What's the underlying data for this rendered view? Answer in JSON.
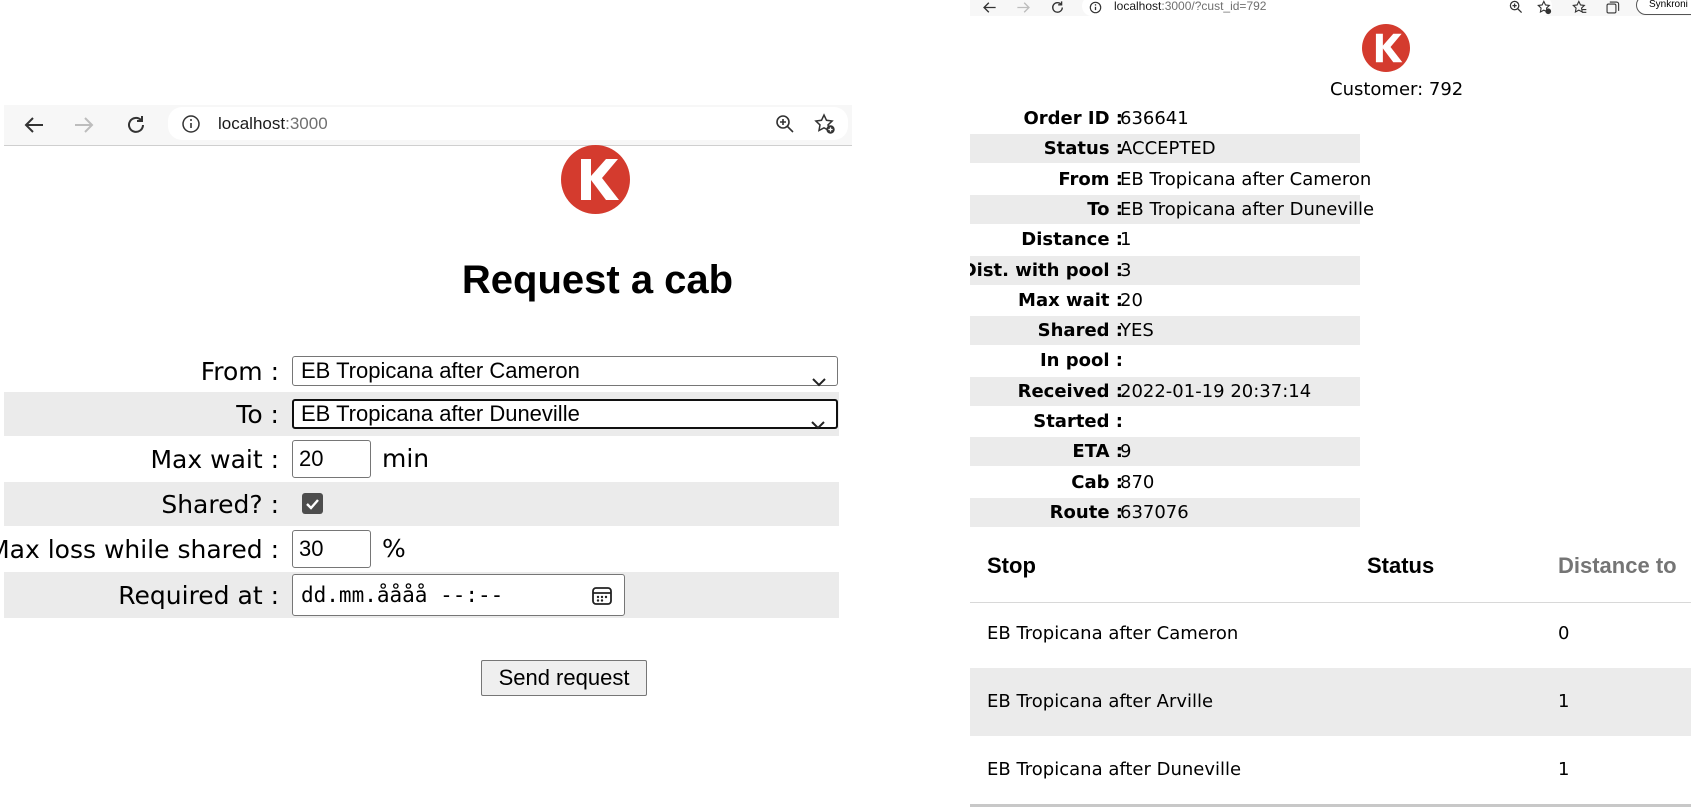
{
  "left": {
    "browser": {
      "url_host": "localhost",
      "url_port": ":3000"
    },
    "form": {
      "title": "Request a cab",
      "rows": {
        "from": {
          "label": "From :",
          "value": "EB Tropicana after Cameron"
        },
        "to": {
          "label": "To :",
          "value": "EB Tropicana after Duneville"
        },
        "max_wait": {
          "label": "Max wait :",
          "value": "20",
          "unit": "min"
        },
        "shared": {
          "label": "Shared? :",
          "checked": true
        },
        "max_loss": {
          "label": "Max loss while shared :",
          "value": "30",
          "unit": "%"
        },
        "required_at": {
          "label": "Required at :",
          "value": "dd.mm.åååå --:--"
        }
      },
      "submit_label": "Send request"
    }
  },
  "right": {
    "browser": {
      "url_host": "localhost",
      "url_rest": ":3000/?cust_id=792",
      "profile_label": "Synkroni"
    },
    "customer_label": "Customer: 792",
    "details": [
      {
        "key": "Order ID :",
        "value": "636641"
      },
      {
        "key": "Status :",
        "value": "ACCEPTED"
      },
      {
        "key": "From :",
        "value": "EB Tropicana after Cameron"
      },
      {
        "key": "To :",
        "value": "EB Tropicana after Duneville"
      },
      {
        "key": "Distance :",
        "value": "1"
      },
      {
        "key": "Dist. with pool :",
        "value": "3"
      },
      {
        "key": "Max wait :",
        "value": "20"
      },
      {
        "key": "Shared :",
        "value": "YES"
      },
      {
        "key": "In pool :",
        "value": ""
      },
      {
        "key": "Received :",
        "value": "2022-01-19 20:37:14"
      },
      {
        "key": "Started :",
        "value": ""
      },
      {
        "key": "ETA :",
        "value": "9"
      },
      {
        "key": "Cab :",
        "value": "870"
      },
      {
        "key": "Route :",
        "value": "637076"
      }
    ],
    "stops_table": {
      "headers": [
        "Stop",
        "Status",
        "Distance to"
      ],
      "rows": [
        [
          "EB Tropicana after Cameron",
          "",
          "0"
        ],
        [
          "EB Tropicana after Arville",
          "",
          "1"
        ],
        [
          "EB Tropicana after Duneville",
          "",
          "1"
        ]
      ]
    }
  },
  "colors": {
    "logo": "#d43b2e",
    "row_shade": "#ebebeb",
    "muted_header": "#757575"
  },
  "icons": [
    "back-arrow-icon",
    "forward-arrow-icon",
    "reload-icon",
    "site-info-icon",
    "zoom-icon",
    "favorite-add-icon",
    "favorites-icon",
    "collections-icon",
    "calendar-icon",
    "chevron-down-icon",
    "checkbox-checked-icon",
    "logo-k"
  ]
}
